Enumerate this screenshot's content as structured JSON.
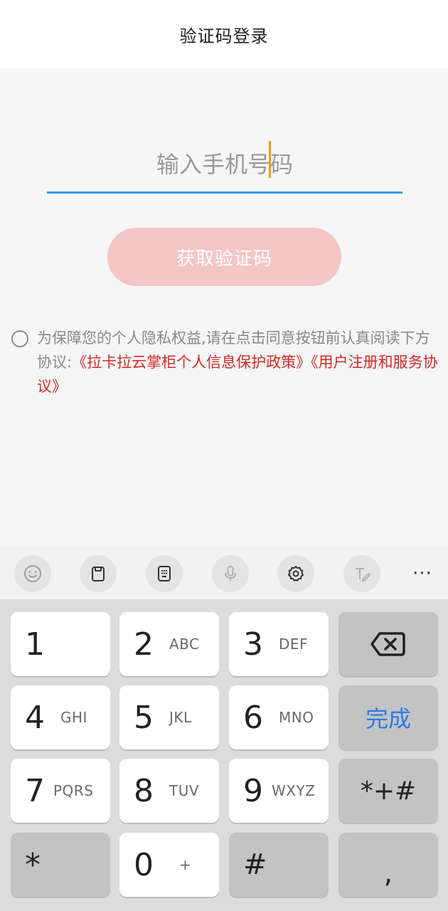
{
  "header": {
    "title": "验证码登录"
  },
  "phone_input": {
    "placeholder": "输入手机号码",
    "value": ""
  },
  "get_code_button": {
    "label": "获取验证码"
  },
  "agreement": {
    "text": "为保障您的个人隐私权益,请在点击同意按钮前认真阅读下方协议:",
    "link1": "《拉卡拉云掌柜个人信息保护政策》",
    "link2": "《用户注册和服务协议》"
  },
  "toolbar": {
    "icons": [
      "emoji-icon",
      "clipboard-icon",
      "keyboard-icon",
      "microphone-icon",
      "settings-icon",
      "handwriting-icon"
    ],
    "more_label": "···"
  },
  "keypad": {
    "keys": [
      {
        "num": "1",
        "letters": ""
      },
      {
        "num": "2",
        "letters": "ABC"
      },
      {
        "num": "3",
        "letters": "DEF"
      },
      {
        "num": "4",
        "letters": "GHI"
      },
      {
        "num": "5",
        "letters": "JKL"
      },
      {
        "num": "6",
        "letters": "MNO"
      },
      {
        "num": "7",
        "letters": "PQRS"
      },
      {
        "num": "8",
        "letters": "TUV"
      },
      {
        "num": "9",
        "letters": "WXYZ"
      },
      {
        "num": "*",
        "letters": ""
      },
      {
        "num": "0",
        "letters": "+"
      },
      {
        "num": "#",
        "letters": ""
      }
    ],
    "done_label": "完成",
    "symbols_label": "*+#",
    "comma_label": ","
  },
  "colors": {
    "accent": "#2f9be3",
    "caret": "#f39c12",
    "link": "#d42828",
    "button_disabled": "#f4c6c6",
    "done": "#2d7be6"
  }
}
